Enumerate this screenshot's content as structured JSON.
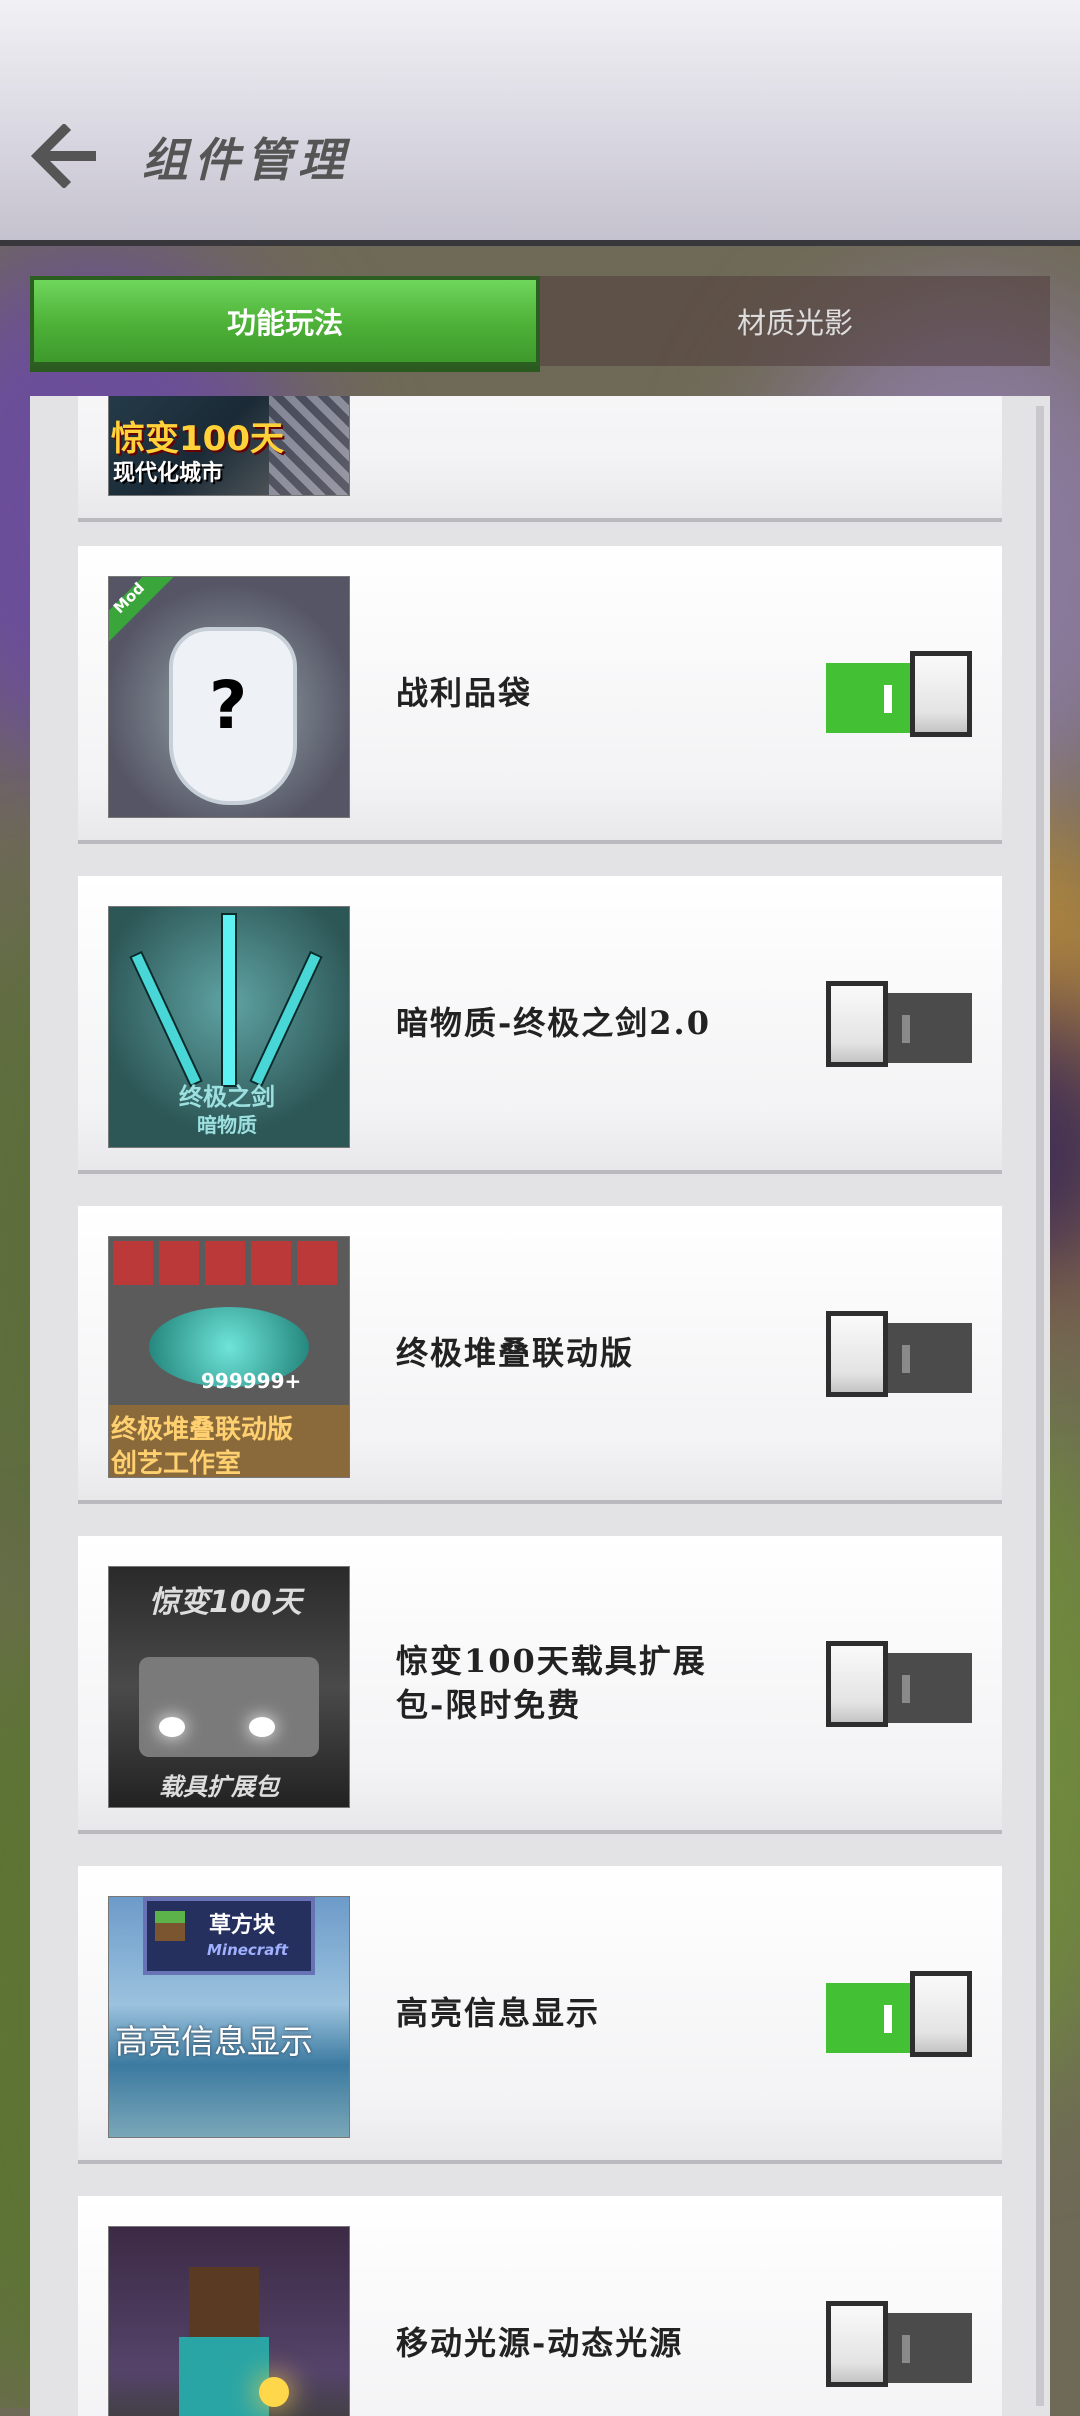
{
  "header": {
    "title": "组件管理",
    "back_icon": "back-arrow-icon"
  },
  "tabs": [
    {
      "label": "功能玩法",
      "active": true
    },
    {
      "label": "材质光影",
      "active": false
    }
  ],
  "list": {
    "items": [
      {
        "name": "",
        "thumb_text": [
          "惊变100天",
          "现代化城市"
        ],
        "enabled": null
      },
      {
        "name": "战利品袋",
        "thumb_text": [
          "Mod",
          "?"
        ],
        "enabled": true
      },
      {
        "name": "暗物质-终极之剑2.0",
        "thumb_text": [
          "终极之剑",
          "暗物质"
        ],
        "enabled": false
      },
      {
        "name": "终极堆叠联动版",
        "thumb_text": [
          "999999+",
          "终极堆叠联动版",
          "创艺工作室"
        ],
        "enabled": false
      },
      {
        "name": "惊变100天载具扩展包-限时免费",
        "thumb_text": [
          "惊变100天",
          "载具扩展包"
        ],
        "enabled": false
      },
      {
        "name": "高亮信息显示",
        "thumb_text": [
          "草方块",
          "Minecraft",
          "高亮信息显示"
        ],
        "enabled": true
      },
      {
        "name": "移动光源-动态光源",
        "thumb_text": [],
        "enabled": false
      }
    ]
  }
}
